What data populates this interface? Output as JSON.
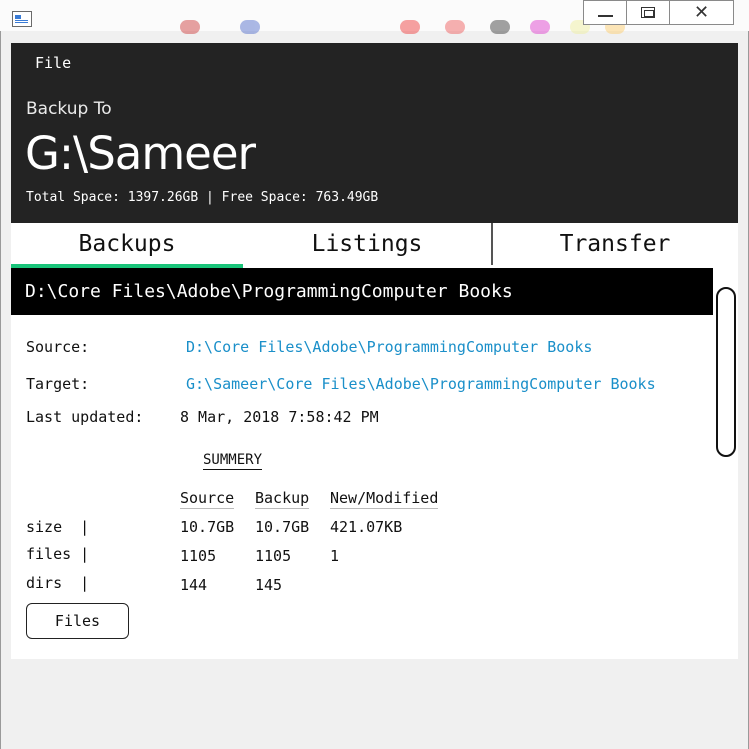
{
  "window": {
    "minimize_icon": "minimize-icon",
    "maximize_icon": "maximize-icon",
    "close_icon": "close-icon",
    "close_glyph": "✕"
  },
  "menu": {
    "file": "File"
  },
  "header": {
    "backup_to_label": "Backup To",
    "drive": "G:\\Sameer",
    "space_info": "Total Space: 1397.26GB | Free Space: 763.49GB"
  },
  "tabs": [
    {
      "label": "Backups",
      "active": true
    },
    {
      "label": "Listings",
      "active": false
    },
    {
      "label": "Transfer",
      "active": false
    }
  ],
  "backup": {
    "path_title": "D:\\Core Files\\Adobe\\ProgrammingComputer Books",
    "source_label": "Source:",
    "source_value": "D:\\Core Files\\Adobe\\ProgrammingComputer Books",
    "target_label": "Target:",
    "target_value": "G:\\Sameer\\Core Files\\Adobe\\ProgrammingComputer Books",
    "updated_label": "Last updated:",
    "updated_value": "8 Mar, 2018 7:58:42 PM"
  },
  "summary": {
    "title": "SUMMERY",
    "columns": [
      "Source",
      "Backup",
      "New/Modified"
    ],
    "rows": [
      {
        "label": "size  |",
        "source": "10.7GB",
        "backup": "10.7GB",
        "new": "421.07KB"
      },
      {
        "label": "files |",
        "source": "1105",
        "backup": "1105",
        "new": "1"
      },
      {
        "label": "dirs  |",
        "source": "144",
        "backup": "145",
        "new": ""
      }
    ],
    "files_button": "Files"
  },
  "colors": {
    "accent": "#19c47a",
    "link": "#1a8fc9",
    "header_bg": "#232323"
  }
}
